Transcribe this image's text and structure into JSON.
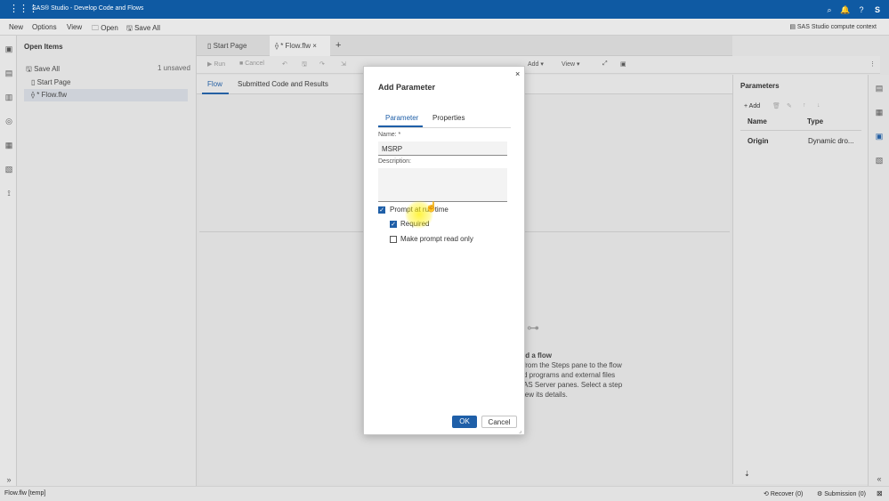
{
  "titlebar": {
    "title": "SAS® Studio - Develop Code and Flows",
    "user_initial": "S"
  },
  "menubar": {
    "new": "New",
    "options": "Options",
    "view": "View",
    "open": "Open",
    "save_all": "Save All",
    "context": "SAS Studio compute context"
  },
  "open_items": {
    "title": "Open Items",
    "save_all": "Save All",
    "unsaved": "1 unsaved",
    "items": [
      "Start Page",
      "* Flow.flw"
    ]
  },
  "tabs": {
    "start_page": "Start Page",
    "flow": "* Flow.flw"
  },
  "toolbar": {
    "run": "Run",
    "cancel": "Cancel",
    "add": "Add",
    "view": "View"
  },
  "subtabs": {
    "flow": "Flow",
    "submitted": "Submitted Code and Results"
  },
  "canvas_hint": {
    "title": "ld a flow",
    "lines": [
      "from the Steps pane to the flow",
      "d programs and external files",
      "AS Server panes. Select a step",
      "iew its details."
    ]
  },
  "parameters_pane": {
    "title": "Parameters",
    "add": "Add",
    "col_name": "Name",
    "col_type": "Type",
    "row_name": "Origin",
    "row_type": "Dynamic dro..."
  },
  "statusbar": {
    "left": "Flow.flw [temp]",
    "recover": "Recover (0)",
    "submission": "Submission (0)"
  },
  "dialog": {
    "title": "Add Parameter",
    "tab_parameter": "Parameter",
    "tab_properties": "Properties",
    "name_label": "Name: *",
    "name_value": "MSRP",
    "description_label": "Description:",
    "description_value": "",
    "prompt_label": "Prompt at run time",
    "prompt_checked": true,
    "required_label": "Required",
    "required_checked": true,
    "readonly_label": "Make prompt read only",
    "readonly_checked": false,
    "ok": "OK",
    "cancel": "Cancel"
  },
  "colors": {
    "brand": "#0f5aa3",
    "primary_button": "#1f5fa8",
    "cursor_highlight": "#fff000"
  }
}
